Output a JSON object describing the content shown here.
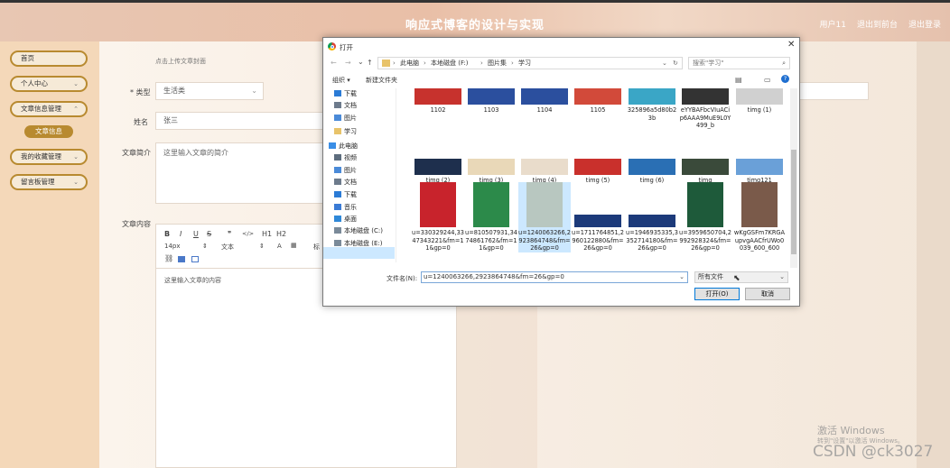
{
  "app": {
    "title": "响应式博客的设计与实现"
  },
  "top_links": {
    "user": "用户11",
    "back_office": "退出到前台",
    "logout": "退出登录"
  },
  "sidebar": {
    "items": [
      {
        "label": "首页"
      },
      {
        "label": "个人中心"
      },
      {
        "label": "文章信息管理"
      },
      {
        "label": "文章信息"
      },
      {
        "label": "我的收藏管理"
      },
      {
        "label": "留言板管理"
      }
    ]
  },
  "form": {
    "upload_hint": "点击上传文章封面",
    "type_label": "* 类型",
    "type_value": "生活类",
    "author_label": "姓名",
    "author_value": "张三",
    "summary_label": "文章简介",
    "summary_placeholder": "这里输入文章的简介",
    "content_label": "文章内容",
    "content_placeholder": "这里输入文章的内容",
    "toolbar": {
      "bold": "B",
      "italic": "I",
      "underline": "U",
      "strike": "S",
      "quote": "❞",
      "code": "</>",
      "h1": "H1",
      "h2": "H2",
      "size": "14px",
      "text": "文本",
      "font": "标"
    }
  },
  "dialog": {
    "title": "打开",
    "breadcrumb": [
      "此电脑",
      "本地磁盘 (F:)",
      "图片集",
      "学习"
    ],
    "search_placeholder": "搜索\"学习\"",
    "organize": "组织 ▾",
    "new_folder": "新建文件夹",
    "nav": [
      {
        "label": "下载",
        "icon": "download-icon",
        "color": "#2b7bd6"
      },
      {
        "label": "文档",
        "icon": "document-icon",
        "color": "#6d7b8c"
      },
      {
        "label": "图片",
        "icon": "pictures-icon",
        "color": "#4a8ad8"
      },
      {
        "label": "学习",
        "icon": "folder-icon",
        "color": "#e8c36a"
      },
      {
        "label": "此电脑",
        "icon": "computer-icon",
        "color": "#3a8ee6"
      },
      {
        "label": "视频",
        "icon": "video-icon",
        "color": "#5d6d7e"
      },
      {
        "label": "图片",
        "icon": "pictures-icon",
        "color": "#4a8ad8"
      },
      {
        "label": "文档",
        "icon": "document-icon",
        "color": "#6d7b8c"
      },
      {
        "label": "下载",
        "icon": "download-icon",
        "color": "#2b7bd6"
      },
      {
        "label": "音乐",
        "icon": "music-icon",
        "color": "#3a7bd5"
      },
      {
        "label": "桌面",
        "icon": "desktop-icon",
        "color": "#2f88d8"
      },
      {
        "label": "本地磁盘 (C:)",
        "icon": "drive-icon",
        "color": "#7a8a99"
      },
      {
        "label": "本地磁盘 (E:)",
        "icon": "drive-icon",
        "color": "#7a8a99"
      },
      {
        "label": "本地磁盘 (F:)",
        "icon": "drive-icon",
        "color": "#7a8a99"
      }
    ],
    "files": [
      {
        "name": "1102",
        "color": "#c7322d"
      },
      {
        "name": "1103",
        "color": "#2b4f9e"
      },
      {
        "name": "1104",
        "color": "#2b4f9e"
      },
      {
        "name": "1105",
        "color": "#d24a3a"
      },
      {
        "name": "325896a5d80b23b",
        "color": "#3aa6c6"
      },
      {
        "name": "eYYBAFbcVIuACip6AAA9MuE9L0Y499_b",
        "color": "#333333"
      },
      {
        "name": "timg (1)",
        "color": "#d0d0d0"
      },
      {
        "name": "timg (2)",
        "color": "#1e2f4d"
      },
      {
        "name": "timg (3)",
        "color": "#e9d8b8"
      },
      {
        "name": "timg (4)",
        "color": "#e9dccb"
      },
      {
        "name": "timg (5)",
        "color": "#c9302c"
      },
      {
        "name": "timg (6)",
        "color": "#2a6fb4"
      },
      {
        "name": "timg",
        "color": "#3a4a3a"
      },
      {
        "name": "timg121",
        "color": "#6aa0d8"
      },
      {
        "name": "u=330329244,3347343221&fm=11&gp=0",
        "color": "#c8232c"
      },
      {
        "name": "u=810507931,3474861762&fm=11&gp=0",
        "color": "#2c8a4a"
      },
      {
        "name": "u=1240063266,2923864748&fm=26&gp=0",
        "color": "#b8c7c0"
      },
      {
        "name": "u=1711764851,2960122880&fm=26&gp=0",
        "color": "#1c3a7a"
      },
      {
        "name": "u=1946935335,3352714180&fm=26&gp=0",
        "color": "#1c3a7a"
      },
      {
        "name": "u=3959650704,2992928324&fm=26&gp=0",
        "color": "#1e5a3a"
      },
      {
        "name": "wKgGSFm7KRGAupvgAACfrUWo0039_600_600",
        "color": "#7a5a4a"
      }
    ],
    "filename_label": "文件名(N):",
    "filename_value": "u=1240063266,2923864748&fm=26&gp=0",
    "filetype_value": "所有文件",
    "open_button": "打开(O)",
    "cancel_button": "取消"
  },
  "watermarks": {
    "activate_title": "激活 Windows",
    "activate_sub": "转到\"设置\"以激活 Windows。",
    "csdn": "CSDN @ck3027"
  }
}
